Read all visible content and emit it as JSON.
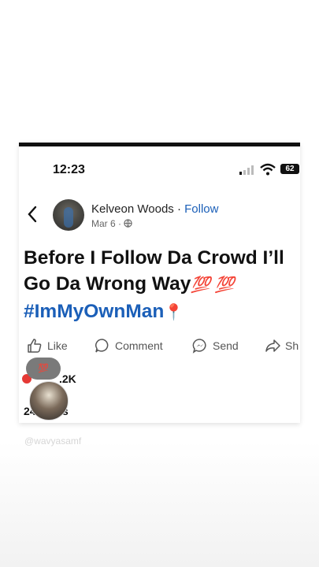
{
  "status": {
    "time": "12:23",
    "battery": "62"
  },
  "author": {
    "name": "Kelveon Woods",
    "separator": " · ",
    "follow_label": "Follow",
    "date": "Mar 6 · "
  },
  "post": {
    "line1": "Before I Follow Da Crowd I’ll",
    "line2": "Go Da Wrong Way",
    "emoji1": "💯 💯",
    "hashtag": "#ImMyOwnMan",
    "pin": "📍"
  },
  "actions": {
    "like": "Like",
    "comment": "Comment",
    "send": "Send",
    "share": "Sh"
  },
  "reactions": {
    "badge": "💯",
    "count": ".2K"
  },
  "shares": {
    "text": "24  hares"
  },
  "watermark": "@wavyasamf",
  "icons": [
    "back-icon",
    "globe-icon",
    "like-icon",
    "comment-icon",
    "messenger-icon",
    "share-icon",
    "signal-icon",
    "wifi-icon",
    "battery-icon"
  ],
  "colors": {
    "link_blue": "#1b5fb8",
    "text": "#111111",
    "muted": "#555555"
  }
}
